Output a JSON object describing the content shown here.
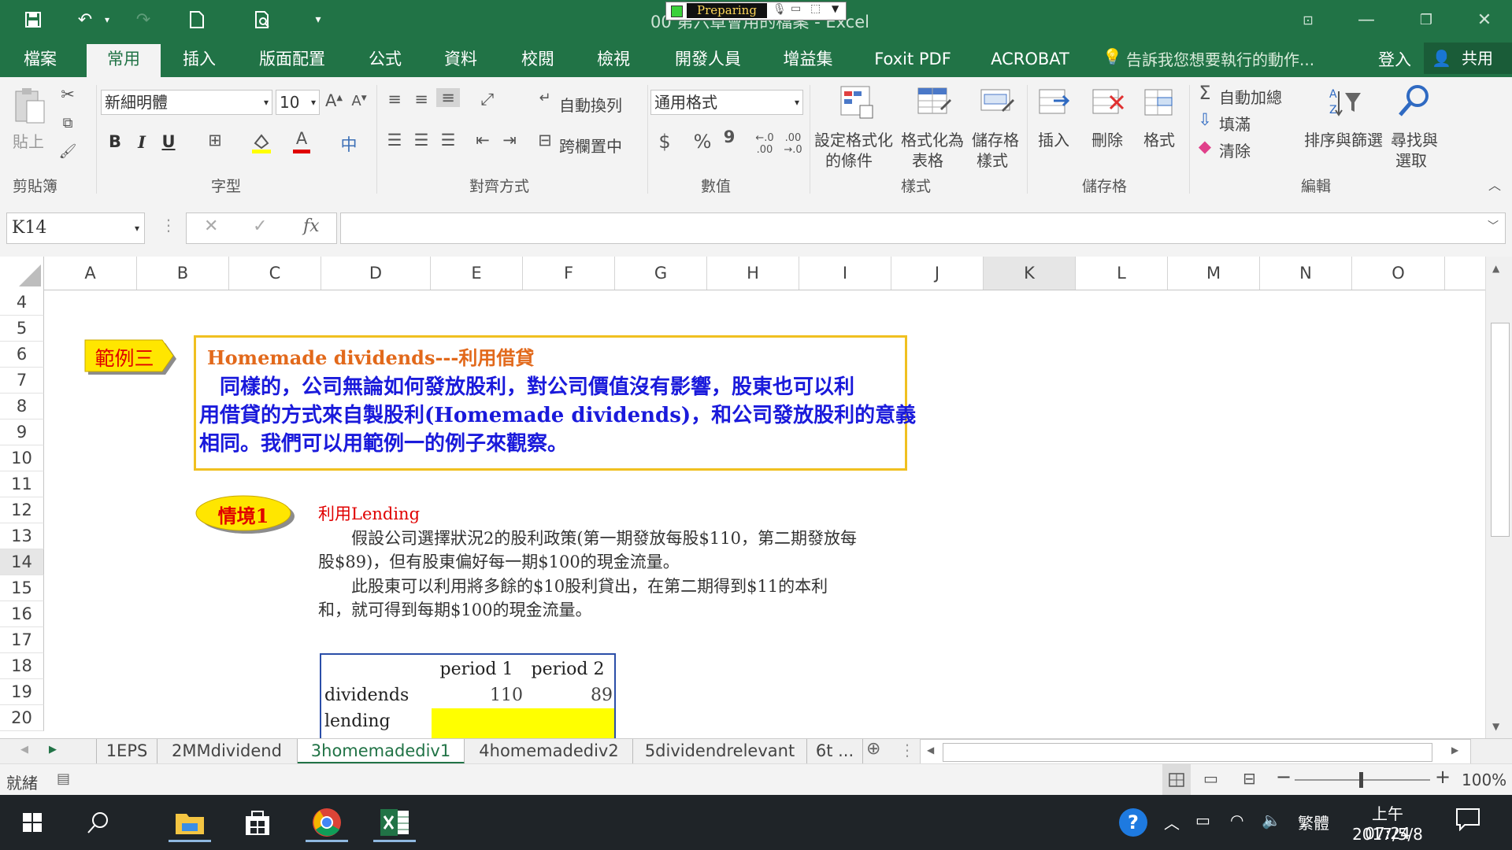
{
  "window": {
    "title": "00 第六章會用的檔案 - Excel",
    "indicator": "Preparing"
  },
  "tabs": [
    "檔案",
    "常用",
    "插入",
    "版面配置",
    "公式",
    "資料",
    "校閱",
    "檢視",
    "開發人員",
    "增益集",
    "Foxit PDF",
    "ACROBAT"
  ],
  "active_tab": "常用",
  "tell_me": "告訴我您想要執行的動作...",
  "login": "登入",
  "share": "共用",
  "ribbon": {
    "clipboard": {
      "paste": "貼上",
      "group": "剪貼簿"
    },
    "font": {
      "name": "新細明體",
      "size": "10",
      "group": "字型",
      "bold": "B",
      "italic": "I",
      "underline": "U",
      "phonetic": "中"
    },
    "align": {
      "wrap": "自動換列",
      "merge": "跨欄置中",
      "group": "對齊方式"
    },
    "number": {
      "format": "通用格式",
      "currency": "$",
      "percent": "%",
      "comma": "9",
      "group": "數值"
    },
    "styles": {
      "cond1": "設定格式化",
      "cond2": "的條件",
      "table1": "格式化為",
      "table2": "表格",
      "cell1": "儲存格",
      "cell2": "樣式",
      "group": "樣式"
    },
    "cells": {
      "insert": "插入",
      "delete": "刪除",
      "format": "格式",
      "group": "儲存格"
    },
    "editing": {
      "autosum": "自動加總",
      "fill": "填滿",
      "clear": "清除",
      "sort": "排序與篩選",
      "find1": "尋找與",
      "find2": "選取",
      "group": "編輯"
    }
  },
  "formula_bar": {
    "name_box": "K14",
    "fx": "fx",
    "content": ""
  },
  "columns": [
    "A",
    "B",
    "C",
    "D",
    "E",
    "F",
    "G",
    "H",
    "I",
    "J",
    "K",
    "L",
    "M",
    "N",
    "O"
  ],
  "rows": [
    "4",
    "5",
    "6",
    "7",
    "8",
    "9",
    "10",
    "11",
    "12",
    "13",
    "14",
    "15",
    "16",
    "17",
    "18",
    "19",
    "20"
  ],
  "sheet": {
    "example_badge": "範例三",
    "box_title": "Homemade dividends---利用借貸",
    "box_line1": "　同樣的，公司無論如何發放股利，對公司價值沒有影響，股東也可以利",
    "box_line2": "用借貸的方式來自製股利(Homemade dividends)，和公司發放股利的意義",
    "box_line3": "相同。我們可以用範例一的例子來觀察。",
    "scenario_badge": "情境1",
    "scenario_title": "利用Lending",
    "para1_line1": "　　假設公司選擇狀況2的股利政策(第一期發放每股$110，第二期發放每",
    "para1_line2": "股$89)，但有股東偏好每一期$100的現金流量。",
    "para2_line1": "　　此股東可以利用將多餘的$10股利貸出，在第二期得到$11的本利",
    "para2_line2": "和，就可得到每期$100的現金流量。",
    "table": {
      "headers": [
        "",
        "period 1",
        "period 2"
      ],
      "dividends_label": "dividends",
      "dividends_p1": "110",
      "dividends_p2": "89",
      "lending_label": "lending"
    }
  },
  "sheet_tabs": [
    "1EPS",
    "2MMdividend",
    "3homemadediv1",
    "4homemadediv2",
    "5dividendrelevant",
    "6t ..."
  ],
  "active_sheet": "3homemadediv1",
  "status": {
    "ready": "就緒",
    "zoom": "100%"
  },
  "taskbar": {
    "ime": "繁體",
    "time": "上午 07:24",
    "date": "2017/5/8"
  },
  "colors": {
    "excel_green": "#217346",
    "badge_yellow": "#ffe600",
    "badge_red_text": "#e00000",
    "box_border": "#f0c020",
    "title_orange": "#e2691b",
    "body_blue": "#1a1adb",
    "lending_fill": "#ffff00",
    "table_border": "#2a4ea8"
  }
}
